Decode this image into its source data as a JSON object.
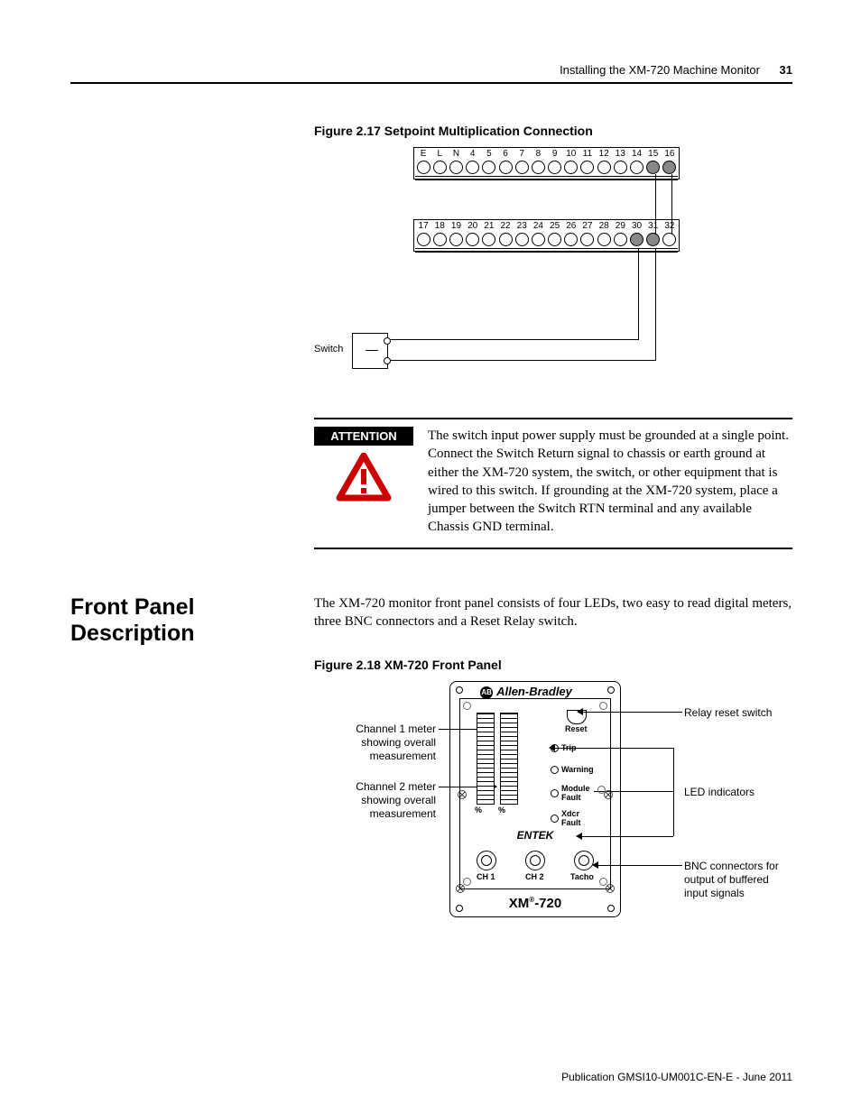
{
  "header": {
    "running_title": "Installing the XM-720 Machine Monitor",
    "page_number": "31"
  },
  "figure217": {
    "caption": "Figure 2.17 Setpoint Multiplication Connection",
    "top_terminals": [
      "E",
      "L",
      "N",
      "4",
      "5",
      "6",
      "7",
      "8",
      "9",
      "10",
      "11",
      "12",
      "13",
      "14",
      "15",
      "16"
    ],
    "bottom_terminals": [
      "17",
      "18",
      "19",
      "20",
      "21",
      "22",
      "23",
      "24",
      "25",
      "26",
      "27",
      "28",
      "29",
      "30",
      "31",
      "32"
    ],
    "switch_label": "Switch"
  },
  "attention": {
    "label": "ATTENTION",
    "body": "The switch input power supply must be grounded at a single point. Connect the Switch Return signal to chassis or earth ground at either the XM-720 system, the switch, or other equipment that is wired to this switch. If grounding at the XM-720 system, place a jumper between the Switch RTN terminal and any available Chassis GND terminal."
  },
  "section": {
    "title": "Front Panel Description",
    "body": "The XM-720 monitor front panel consists of four LEDs, two easy to read digital meters, three BNC connectors and a Reset Relay switch."
  },
  "figure218": {
    "caption": "Figure 2.18 XM-720 Front Panel",
    "labels_left": {
      "ch1": "Channel 1 meter\nshowing overall\nmeasurement",
      "ch2": "Channel 2 meter\nshowing overall\nmeasurement"
    },
    "labels_right": {
      "reset": "Relay reset switch",
      "leds": "LED indicators",
      "bnc": "BNC connectors for\noutput of buffered\ninput signals"
    },
    "panel": {
      "brand": "Allen-Bradley",
      "entek": "ENTEK",
      "reset": "Reset",
      "trip": "Trip",
      "warning": "Warning",
      "module1": "Module",
      "module2": "Fault",
      "xdcr1": "Xdcr",
      "xdcr2": "Fault",
      "ch1": "CH 1",
      "ch2": "CH 2",
      "tacho": "Tacho",
      "model_prefix": "XM",
      "model_suffix": "-720"
    }
  },
  "footer": "Publication GMSI10-UM001C-EN-E - June 2011"
}
